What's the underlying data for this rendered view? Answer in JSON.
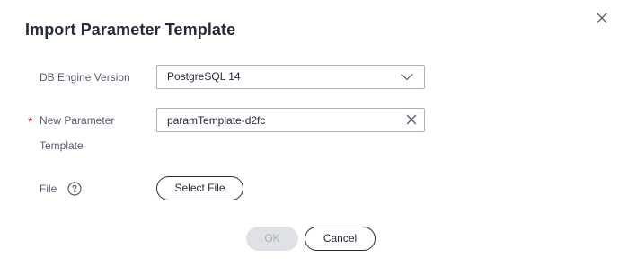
{
  "dialog": {
    "title": "Import Parameter Template",
    "close_icon": "close-icon"
  },
  "form": {
    "db_engine_version": {
      "label": "DB Engine Version",
      "value": "PostgreSQL 14",
      "icon": "chevron-down-icon"
    },
    "new_parameter_template": {
      "required_mark": "*",
      "label_line1": "New Parameter",
      "label_line2": "Template",
      "value": "paramTemplate-d2fc",
      "clear_icon": "clear-icon"
    },
    "file": {
      "label": "File",
      "help_icon": "help-icon",
      "button_label": "Select File"
    }
  },
  "footer": {
    "ok_label": "OK",
    "cancel_label": "Cancel"
  },
  "colors": {
    "text": "#252b3a",
    "label": "#575d6c",
    "required": "#e63d3d",
    "border": "#adb0b8",
    "disabled_bg": "#dfe1e6",
    "disabled_text": "#adb0b8"
  }
}
